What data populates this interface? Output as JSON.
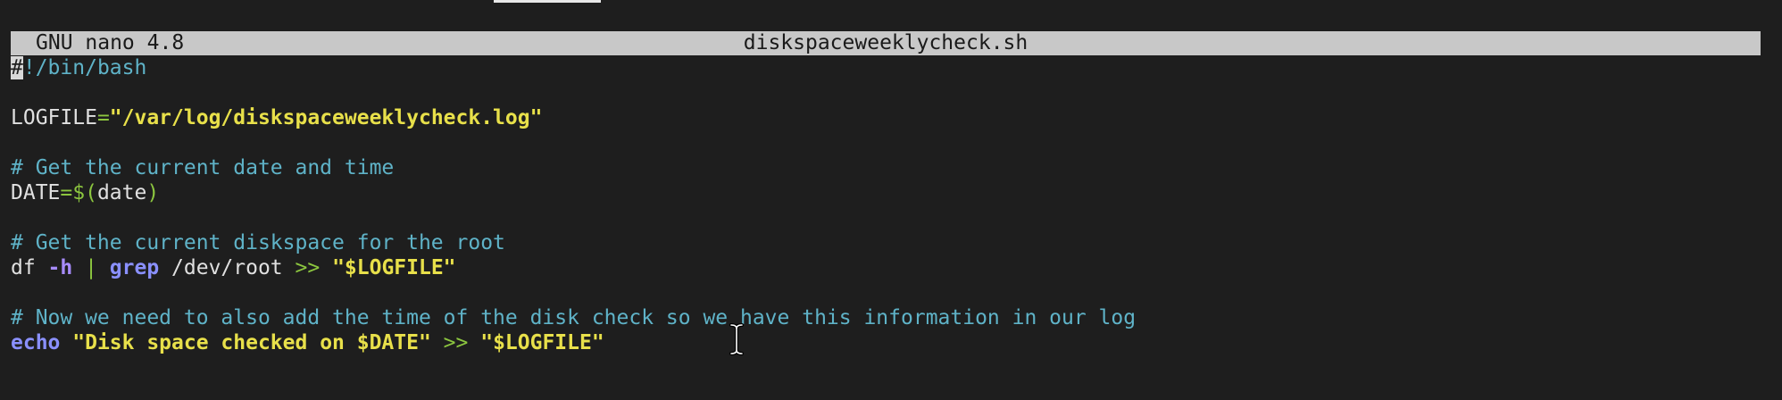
{
  "titlebar": {
    "app_version": "GNU nano 4.8",
    "filename": "diskspaceweeklycheck.sh"
  },
  "editor": {
    "lines": {
      "l1": {
        "cursor_char": "#",
        "rest": "!/bin/bash"
      },
      "l3": {
        "var": "LOGFILE",
        "eq": "=",
        "value": "\"/var/log/diskspaceweeklycheck.log\""
      },
      "l5": {
        "comment": "# Get the current date and time"
      },
      "l6": {
        "var": "DATE",
        "eq": "=$(",
        "cmd": "date",
        "close": ")"
      },
      "l8": {
        "comment": "# Get the current diskspace for the root"
      },
      "l9": {
        "cmd": "df ",
        "opt": "-h",
        "pipe": " | ",
        "grep": "grep",
        "path": " /dev/root ",
        "redir": ">> ",
        "target": "\"$LOGFILE\""
      },
      "l11": {
        "comment": "# Now we need to also add the time of the disk check so we have this information in our log"
      },
      "l12": {
        "kw": "echo",
        "sp": " ",
        "str": "\"Disk space checked on $DATE\"",
        "redir": " >> ",
        "target": "\"$LOGFILE\""
      }
    }
  },
  "icons": {
    "text_cursor": "i-beam-cursor-icon"
  },
  "colors": {
    "background": "#1e1e1e",
    "titlebar": "#c8c8c8",
    "comment": "#5fb3c8",
    "string": "#e8e04a",
    "keyword": "#8a90ff",
    "operator": "#8cc63f"
  }
}
